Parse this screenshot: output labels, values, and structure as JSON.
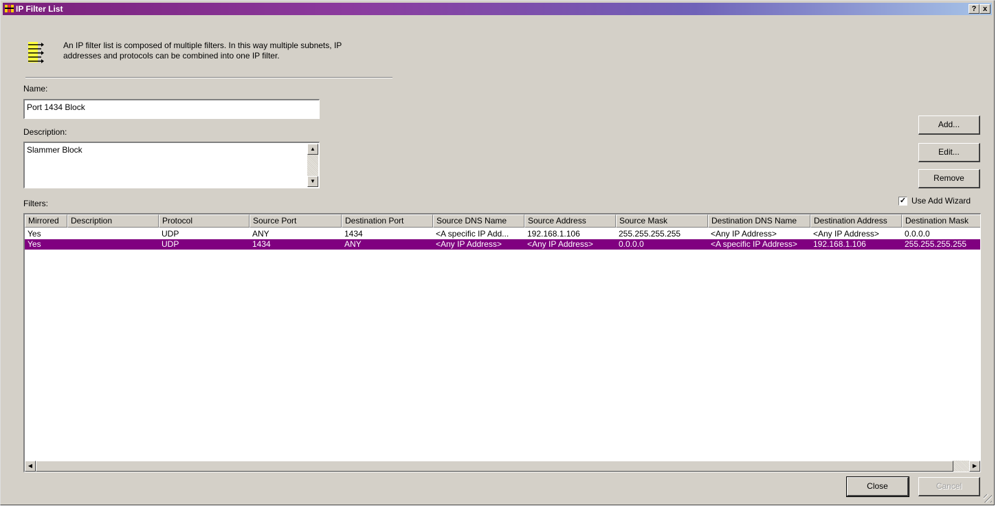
{
  "window": {
    "title": "IP Filter List",
    "help_label": "?",
    "close_label": "x"
  },
  "intro": {
    "text_line1": "An IP filter list is composed of multiple filters. In this way multiple subnets, IP",
    "text_line2": "addresses and protocols can be combined into one IP filter."
  },
  "name": {
    "label": "Name:",
    "value": "Port 1434 Block"
  },
  "description": {
    "label": "Description:",
    "value": "Slammer Block"
  },
  "buttons": {
    "add": "Add...",
    "edit": "Edit...",
    "remove": "Remove",
    "close": "Close",
    "cancel": "Cancel"
  },
  "wizard": {
    "label": "Use Add Wizard",
    "checked": true
  },
  "filters": {
    "label": "Filters:",
    "columns": [
      "Mirrored",
      "Description",
      "Protocol",
      "Source Port",
      "Destination Port",
      "Source DNS Name",
      "Source Address",
      "Source Mask",
      "Destination DNS Name",
      "Destination Address",
      "Destination Mask"
    ],
    "rows": [
      {
        "selected": false,
        "cells": [
          "Yes",
          "",
          "UDP",
          "ANY",
          "1434",
          "<A specific IP Add...",
          "192.168.1.106",
          "255.255.255.255",
          "<Any IP Address>",
          "<Any IP Address>",
          "0.0.0.0"
        ]
      },
      {
        "selected": true,
        "cells": [
          "Yes",
          "",
          "UDP",
          "1434",
          "ANY",
          "<Any IP Address>",
          "<Any IP Address>",
          "0.0.0.0",
          "<A specific IP Address>",
          "192.168.1.106",
          "255.255.255.255"
        ]
      }
    ]
  },
  "colors": {
    "selection": "#800080",
    "title_start": "#7a1f7a",
    "title_end": "#a6c4e8",
    "face": "#d4d0c8"
  }
}
